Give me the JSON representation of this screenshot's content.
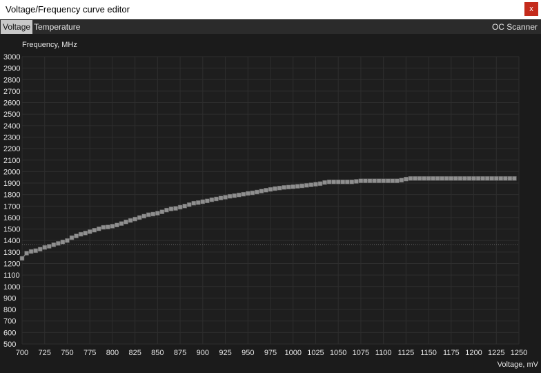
{
  "window": {
    "title": "Voltage/Frequency curve editor",
    "close_label": "x"
  },
  "tabs": [
    {
      "label": "Voltage",
      "active": true
    },
    {
      "label": "Temperature",
      "active": false
    }
  ],
  "oc_scanner_label": "OC Scanner",
  "colors": {
    "background": "#1b1b1b",
    "grid": "#2e2e2e",
    "curve": "#8a8a8a",
    "text": "#e6e6e6",
    "reference_line": "#6a6a6a"
  },
  "chart_data": {
    "type": "line",
    "ylabel": "Frequency, MHz",
    "xlabel": "Voltage, mV",
    "xlim": [
      700,
      1250
    ],
    "ylim": [
      500,
      3000
    ],
    "x_ticks": [
      700,
      725,
      750,
      775,
      800,
      825,
      850,
      875,
      900,
      925,
      950,
      975,
      1000,
      1025,
      1050,
      1075,
      1100,
      1125,
      1150,
      1175,
      1200,
      1225,
      1250
    ],
    "y_ticks": [
      500,
      600,
      700,
      800,
      900,
      1000,
      1100,
      1200,
      1300,
      1400,
      1500,
      1600,
      1700,
      1800,
      1900,
      2000,
      2100,
      2200,
      2300,
      2400,
      2500,
      2600,
      2700,
      2800,
      2900,
      3000
    ],
    "reference_frequency": 1365,
    "grid": true,
    "series": [
      {
        "x": [
          700,
          705,
          710,
          715,
          720,
          725,
          730,
          735,
          740,
          745,
          750,
          755,
          760,
          765,
          770,
          775,
          780,
          785,
          790,
          795,
          800,
          805,
          810,
          815,
          820,
          825,
          830,
          835,
          840,
          845,
          850,
          855,
          860,
          865,
          870,
          875,
          880,
          885,
          890,
          895,
          900,
          905,
          910,
          915,
          920,
          925,
          930,
          935,
          940,
          945,
          950,
          955,
          960,
          965,
          970,
          975,
          980,
          985,
          990,
          995,
          1000,
          1005,
          1010,
          1015,
          1020,
          1025,
          1030,
          1035,
          1040,
          1045,
          1050,
          1055,
          1060,
          1065,
          1070,
          1075,
          1080,
          1085,
          1090,
          1095,
          1100,
          1105,
          1110,
          1115,
          1120,
          1125,
          1130,
          1135,
          1140,
          1145,
          1150,
          1155,
          1160,
          1165,
          1170,
          1175,
          1180,
          1185,
          1190,
          1195,
          1200,
          1205,
          1210,
          1215,
          1220,
          1225,
          1230,
          1235,
          1240,
          1245
        ],
        "y": [
          1245,
          1290,
          1305,
          1312,
          1325,
          1340,
          1350,
          1363,
          1375,
          1388,
          1400,
          1425,
          1440,
          1455,
          1465,
          1477,
          1490,
          1502,
          1515,
          1518,
          1525,
          1535,
          1548,
          1562,
          1575,
          1587,
          1600,
          1612,
          1625,
          1630,
          1638,
          1650,
          1665,
          1675,
          1680,
          1690,
          1700,
          1712,
          1725,
          1730,
          1738,
          1745,
          1755,
          1762,
          1770,
          1777,
          1785,
          1790,
          1797,
          1803,
          1810,
          1815,
          1822,
          1830,
          1838,
          1845,
          1852,
          1857,
          1862,
          1865,
          1868,
          1872,
          1876,
          1880,
          1885,
          1890,
          1895,
          1905,
          1910,
          1910,
          1910,
          1910,
          1910,
          1910,
          1915,
          1920,
          1920,
          1920,
          1920,
          1920,
          1920,
          1920,
          1920,
          1920,
          1925,
          1935,
          1940,
          1940,
          1940,
          1940,
          1940,
          1940,
          1940,
          1940,
          1940,
          1940,
          1940,
          1940,
          1940,
          1940,
          1940,
          1940,
          1940,
          1940,
          1940,
          1940,
          1940,
          1940,
          1940,
          1940
        ]
      }
    ]
  }
}
